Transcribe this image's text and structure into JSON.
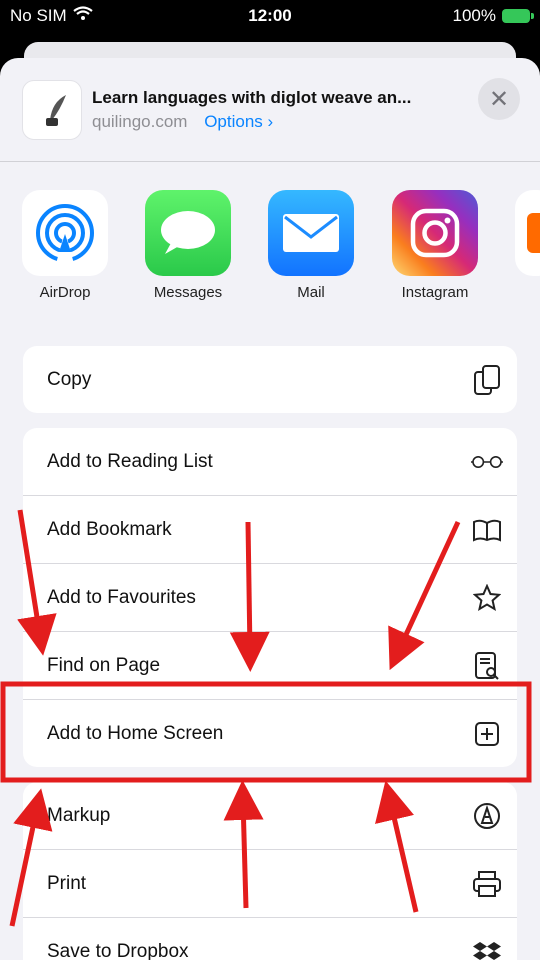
{
  "status": {
    "carrier": "No SIM",
    "time": "12:00",
    "battery": "100%"
  },
  "header": {
    "title": "Learn languages with diglot weave an...",
    "domain": "quilingo.com",
    "options_label": "Options ›"
  },
  "apps": [
    {
      "label": "AirDrop",
      "icon": "airdrop-icon"
    },
    {
      "label": "Messages",
      "icon": "messages-icon"
    },
    {
      "label": "Mail",
      "icon": "mail-icon"
    },
    {
      "label": "Instagram",
      "icon": "instagram-icon"
    }
  ],
  "actions": {
    "copy": {
      "label": "Copy",
      "icon": "copy-icon"
    },
    "group2": [
      {
        "label": "Add to Reading List",
        "icon": "glasses-icon"
      },
      {
        "label": "Add Bookmark",
        "icon": "book-icon"
      },
      {
        "label": "Add to Favourites",
        "icon": "star-icon"
      },
      {
        "label": "Find on Page",
        "icon": "find-page-icon"
      },
      {
        "label": "Add to Home Screen",
        "icon": "add-square-icon"
      }
    ],
    "group3": [
      {
        "label": "Markup",
        "icon": "markup-icon"
      },
      {
        "label": "Print",
        "icon": "printer-icon"
      },
      {
        "label": "Save to Dropbox",
        "icon": "dropbox-icon"
      }
    ]
  },
  "colors": {
    "accent": "#0a84ff",
    "annotation": "#e31d1d"
  }
}
